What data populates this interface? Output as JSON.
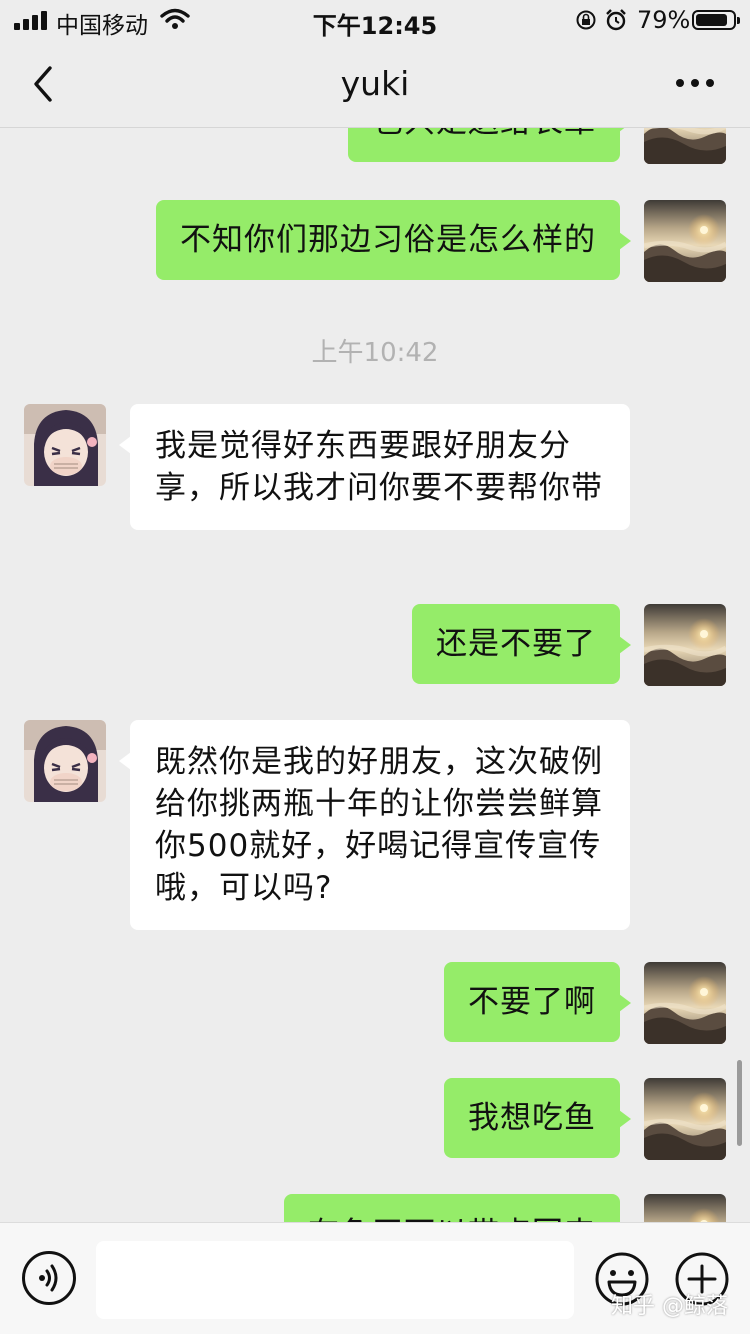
{
  "status": {
    "carrier": "中国移动",
    "time": "下午12:45",
    "battery": "79%",
    "battery_level": 0.79
  },
  "nav": {
    "title": "yuki",
    "more": "•••"
  },
  "messages": [
    {
      "from": "me",
      "text": "也只是送给长辈"
    },
    {
      "from": "me",
      "text": "不知你们那边习俗是怎么样的"
    },
    {
      "type": "time",
      "text": "上午10:42"
    },
    {
      "from": "yuki",
      "text": "我是觉得好东西要跟好朋友分享，所以我才问你要不要帮你带"
    },
    {
      "from": "me",
      "text": "还是不要了"
    },
    {
      "from": "yuki",
      "text": "既然你是我的好朋友，这次破例给你挑两瓶十年的让你尝尝鲜算你500就好，好喝记得宣传宣传哦，可以吗?"
    },
    {
      "from": "me",
      "text": "不要了啊"
    },
    {
      "from": "me",
      "text": "我想吃鱼"
    },
    {
      "from": "me",
      "text": "有鱼干可以带点回来"
    }
  ],
  "input": {
    "value": "",
    "placeholder": ""
  },
  "watermark": "知乎 @鲸落",
  "icons": {
    "back": "chevron-left-icon",
    "more": "more-dots-icon",
    "voice": "voice-icon",
    "emoji": "emoji-icon",
    "plus": "plus-icon"
  },
  "colors": {
    "background": "#ededed",
    "outgoing_bubble": "#95ec69",
    "incoming_bubble": "#ffffff",
    "timestamp": "#b2b2b2"
  }
}
